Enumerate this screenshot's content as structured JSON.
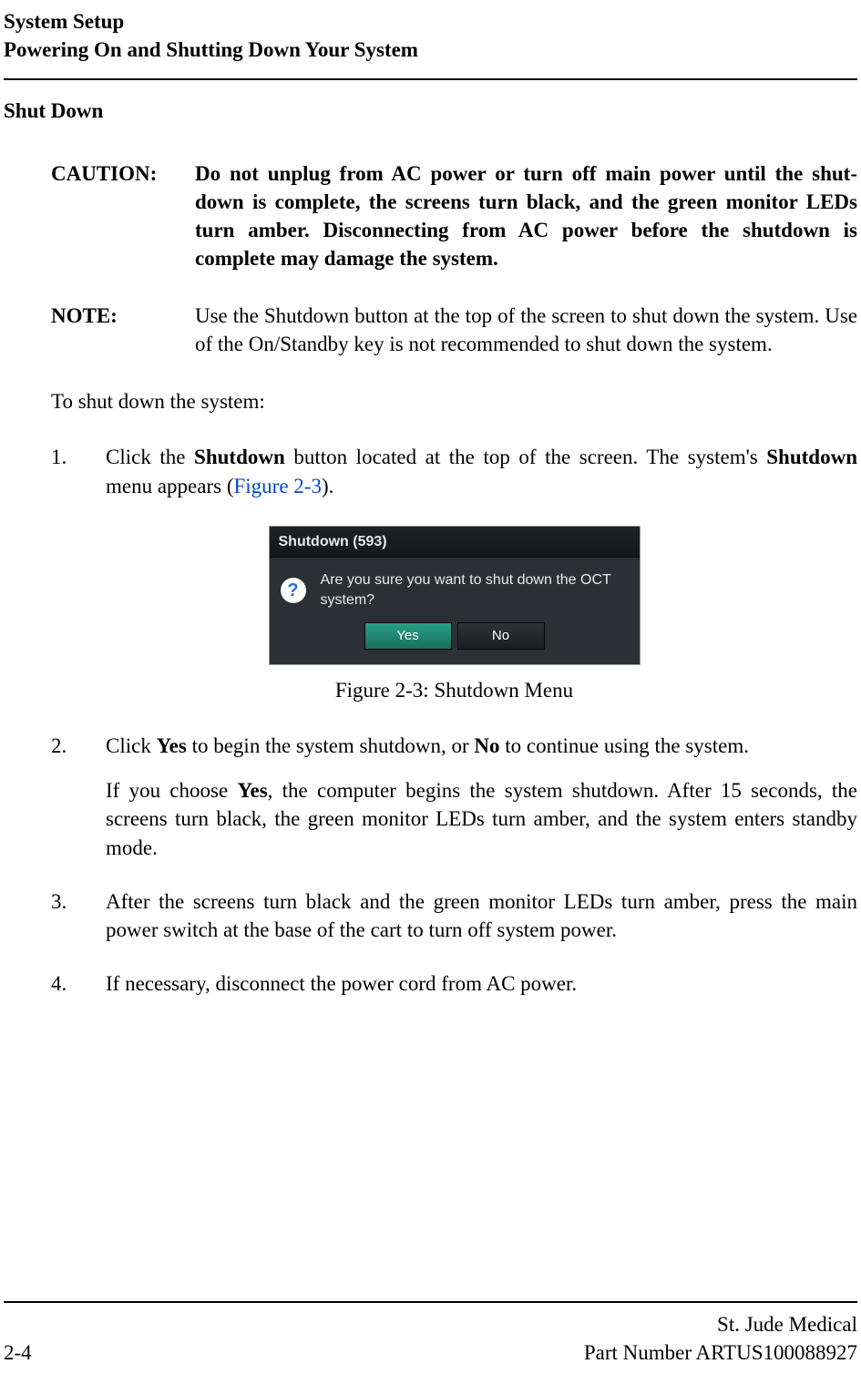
{
  "header": {
    "line1": "System Setup",
    "line2": "Powering On and Shutting Down Your System"
  },
  "section_heading": "Shut Down",
  "caution": {
    "label": "CAUTION:",
    "body": "Do not unplug from AC power or turn off main power until the shut-down is complete, the screens turn black, and the green monitor LEDs turn amber. Disconnecting from AC power before the shutdown is complete may damage the system."
  },
  "note": {
    "label": "NOTE:",
    "body": "Use the Shutdown button at the top of the screen to shut down the system. Use of the On/Standby key is not recommended to shut down the system."
  },
  "intro": "To shut down the system:",
  "steps": {
    "s1": {
      "num": "1.",
      "pre": "Click the ",
      "b1": "Shutdown",
      "mid": " button located at the top of the screen. The system's ",
      "b2": "Shutdown",
      "post1": " menu appears (",
      "figref": "Figure 2-3",
      "post2": ")."
    },
    "s2": {
      "num": "2.",
      "pre": "Click ",
      "b1": "Yes",
      "mid": " to begin the system shutdown, or ",
      "b2": "No",
      "post": " to continue using the system.",
      "para2_pre": "If you choose ",
      "para2_b": "Yes",
      "para2_post": ", the computer begins the system shutdown. After 15 seconds, the screens turn black, the green monitor LEDs turn amber, and the system enters standby mode."
    },
    "s3": {
      "num": "3.",
      "text": "After the screens turn black and the green monitor LEDs turn amber, press the main power switch at the base of the cart to turn off system power."
    },
    "s4": {
      "num": "4.",
      "text": "If necessary, disconnect the power cord from AC power."
    }
  },
  "dialog": {
    "title": "Shutdown (593)",
    "message": "Are you sure you want to shut down the OCT system?",
    "yes_label": "Yes",
    "no_label": "No",
    "help_glyph": "?"
  },
  "figure_caption": "Figure 2-3:  Shutdown Menu",
  "footer": {
    "page": "2-4",
    "company": "St. Jude Medical",
    "partnum": "Part Number ARTUS100088927"
  }
}
